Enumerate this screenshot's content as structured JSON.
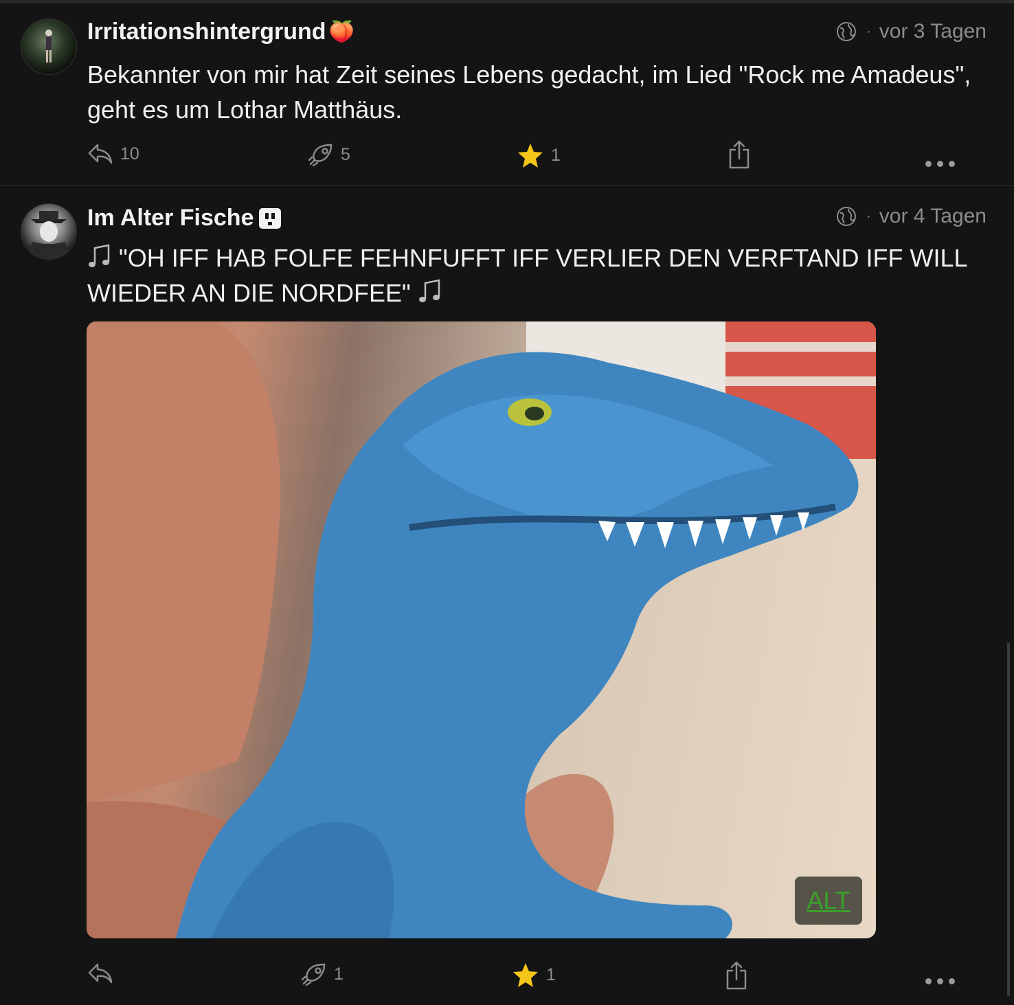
{
  "posts": [
    {
      "author": "Irritationshintergrund",
      "author_emoji": "🍑",
      "visibility_icon": "globe-icon",
      "separator": "·",
      "time": "vor 3 Tagen",
      "text": "Bekannter von mir hat Zeit seines Lebens gedacht, im Lied \"Rock me Amadeus\", geht es um Lothar Matthäus.",
      "replies": "10",
      "boosts": "5",
      "favourites": "1"
    },
    {
      "author": "Im Alter Fische",
      "visibility_icon": "globe-icon",
      "separator": "·",
      "time": "vor 4 Tagen",
      "text": "\"OH IFF HAB FOLFE FEHNFUFFT IFF VERLIER DEN VERFTAND IFF WILL WIEDER AN DIE NORDFEE\"",
      "media_alt_label": "ALT",
      "replies": "",
      "boosts": "1",
      "favourites": "1"
    }
  ],
  "colors": {
    "background": "#141414",
    "text": "#f0f0f0",
    "muted": "#8c8c8c",
    "star": "#f5c518",
    "alt_text": "#3aa12a"
  }
}
